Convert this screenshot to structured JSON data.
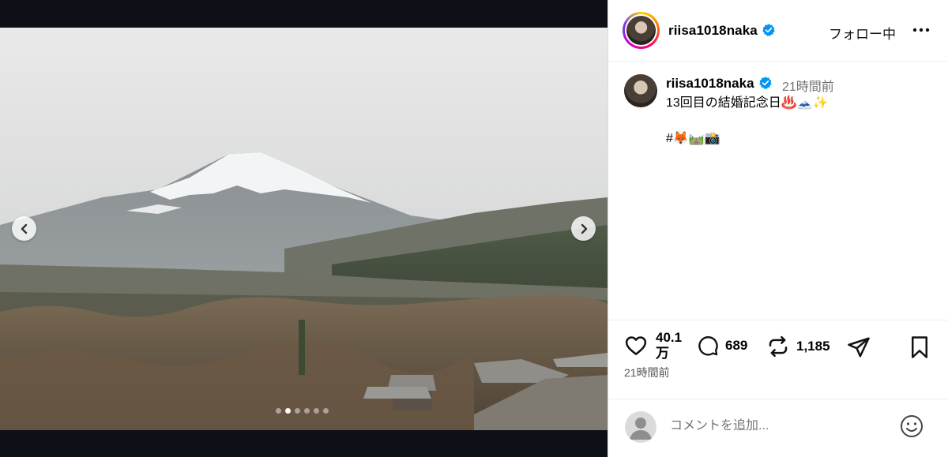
{
  "post": {
    "username": "riisa1018naka",
    "follow_status": "フォロー中",
    "caption_time": "21時間前",
    "caption_text": "13回目の結婚記念日♨️🗻✨",
    "caption_tags": "#🦊🛤️📸",
    "likes": "40.1万",
    "comments": "689",
    "reposts": "1,185",
    "post_time": "21時間前"
  },
  "carousel": {
    "slide_count": 6,
    "active_slide": 2
  },
  "comment_box": {
    "placeholder": "コメントを追加..."
  },
  "icons": {
    "prev": "chevron-left-icon",
    "next": "chevron-right-icon",
    "verified": "verified-badge-icon",
    "more": "more-options-icon",
    "like": "heart-icon",
    "comment": "comment-bubble-icon",
    "repost": "repost-icon",
    "share": "send-icon",
    "save": "bookmark-icon",
    "emoji": "emoji-icon"
  },
  "colors": {
    "verified": "#0095f6",
    "muted_text": "#737373",
    "media_background": "#0d1017"
  }
}
